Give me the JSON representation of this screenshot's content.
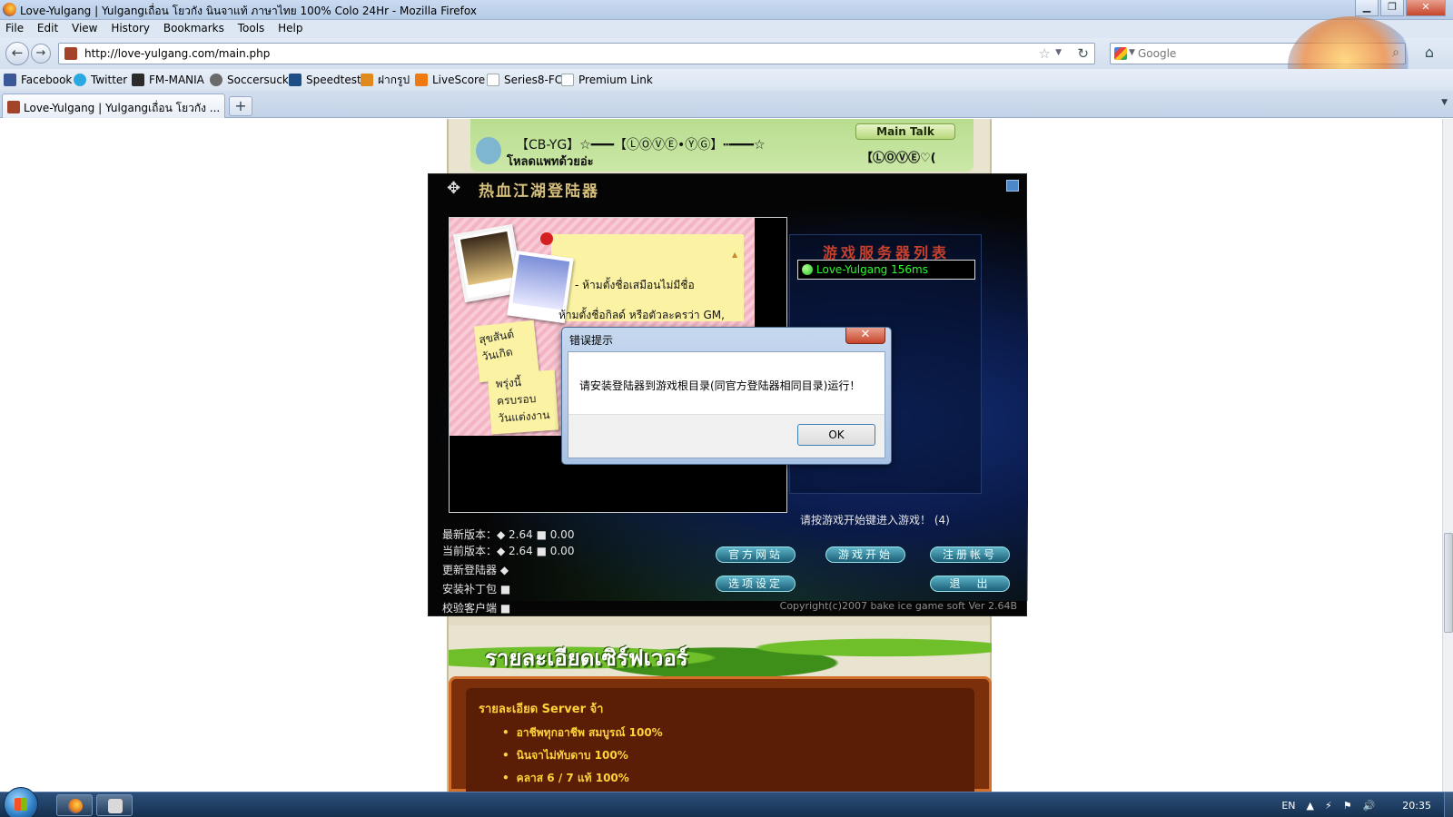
{
  "browser": {
    "window_title": "Love-Yulgang | Yulgangเถื่อน โยวกัง นินจาแท้ ภาษาไทย 100% Colo 24Hr - Mozilla Firefox",
    "menu": [
      "File",
      "Edit",
      "View",
      "History",
      "Bookmarks",
      "Tools",
      "Help"
    ],
    "url": "http://love-yulgang.com/main.php",
    "search_placeholder": "Google",
    "bookmarks": [
      {
        "label": "Facebook",
        "color": "#3b5998"
      },
      {
        "label": "Twitter",
        "color": "#2aa9e0"
      },
      {
        "label": "FM-MANIA",
        "color": "#2b2b2b"
      },
      {
        "label": "Soccersuck",
        "color": "#6a6a6a"
      },
      {
        "label": "Speedtest",
        "color": "#1d4f86"
      },
      {
        "label": "ฝากรูป",
        "color": "#e08a1e"
      },
      {
        "label": "LiveScore",
        "color": "#f07a10"
      },
      {
        "label": "Series8-FC",
        "color": "#ffffff"
      },
      {
        "label": "Premium Link",
        "color": "#ffffff"
      }
    ],
    "tab_label": "Love-Yulgang | Yulgangเถื่อน โยวกัง ...",
    "new_tab": "+"
  },
  "site": {
    "chat_line1": "【CB-YG】☆━━━【ⓁⓄⓋⒺ•ⓎⒼ】┅━━━☆",
    "chat_line2": "โหลดแพทด้วยอ่ะ",
    "main_talk": "Main Talk",
    "chat_user": "【ⓁⓄⓋⒺ♡(",
    "server_banner": "รายละเอียดเซิร์ฟเวอร์",
    "server_heading": "รายละเอียด Server จ้า",
    "server_items": [
      "อาชีพทุกอาชีพ สมบูรณ์ 100%",
      "นินจาไม่ทับดาบ 100%",
      "คลาส 6 / 7 แท้ 100%"
    ]
  },
  "launcher": {
    "title": "热血江湖登陆器",
    "notice_rules": [
      "- ห้ามตั้งชื่อเสมือนไม่มีชื่อ",
      "ห้ามตั้งชื่อกิลด์ หรือตัวละครว่า GM,"
    ],
    "notice_hand1": "สุขสันต์\nวันเกิด",
    "notice_hand2": "พรุ่งนี้\nครบรอบ\nวันแต่งงาน",
    "server_list_header": "游戏服务器列表",
    "server_entry": "Love-Yulgang 156ms",
    "press_play": "请按游戏开始键进入游戏！ (4)",
    "latest_version": "最新版本：◆ 2.64 ■ 0.00",
    "current_version": "当前版本：◆ 2.64 ■ 0.00",
    "update_launcher": "更新登陆器 ◆",
    "install_patch": "安装补丁包 ■",
    "verify_client": "校验客户端 ■",
    "btn_official": "官方网站",
    "btn_start": "游戏开始",
    "btn_register": "注册帐号",
    "btn_options": "选项设定",
    "btn_exit": "退　出",
    "copyright": "Copyright(c)2007 bake ice game soft Ver 2.64B"
  },
  "dialog": {
    "title": "错误提示",
    "message": "请安装登陆器到游戏根目录(同官方登陆器相同目录)运行！",
    "ok": "OK",
    "close": "✕"
  },
  "taskbar": {
    "lang": "EN",
    "clock": "20:35"
  }
}
